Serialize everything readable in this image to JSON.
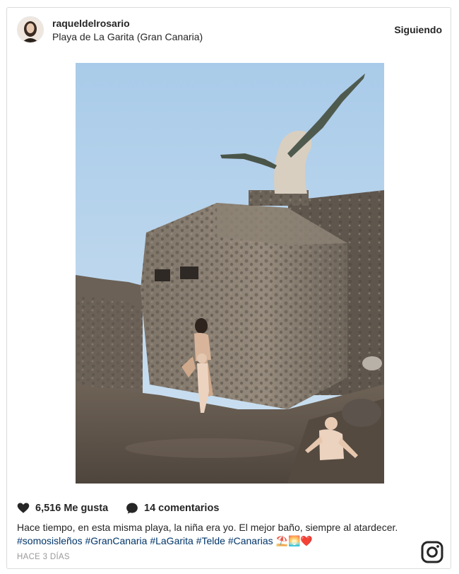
{
  "post": {
    "username": "raqueldelrosario",
    "location": "Playa de La Garita (Gran Canaria)",
    "follow_label": "Siguiendo",
    "likes": "6,516 Me gusta",
    "comments": "14 comentarios",
    "caption_text": "Hace tiempo, en esta misma playa, la niña era yo. El mejor baño, siempre al atardecer. ",
    "caption_tags": "#somosisleños #GranCanaria #LaGarita #Telde #Canarias",
    "caption_emoji": " ⛱️🌅❤️",
    "time_ago": "HACE 3 DÍAS"
  },
  "icons": {
    "avatar": "avatar-photo",
    "like": "heart-icon",
    "comment": "comment-bubble-icon",
    "brand": "instagram-icon"
  },
  "colors": {
    "text": "#262626",
    "hashtag": "#003569",
    "muted": "#999999",
    "border": "#dbdbdb"
  }
}
